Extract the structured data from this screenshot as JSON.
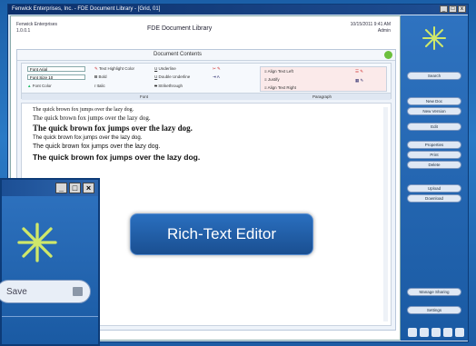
{
  "window": {
    "title": "Fenwick Enterprises, Inc. - FDE Document Library - [Grid, 01]"
  },
  "header": {
    "left_lines": [
      "Fenwick Enterprises",
      "1.0.0.1"
    ],
    "title": "FDE Document Library",
    "right_lines": [
      "10/15/2011 9:41 AM",
      "Admin"
    ]
  },
  "panel": {
    "title": "Document Contents"
  },
  "ribbon": {
    "font_select": "Font Arial",
    "size_select": "Font Size 10",
    "color_select": "Font Color",
    "items": {
      "highlight": "Text Highlight Color",
      "bold": "Bold",
      "italic": "Italic",
      "underline": "Underline",
      "double_underline": "Double Underline",
      "strikethrough": "Strikethrough",
      "align_center": "Align Text Left",
      "justify": "Justify",
      "align_right": "Align Text Right"
    },
    "group_font": "Font",
    "group_paragraph": "Paragraph"
  },
  "document": {
    "lines": [
      "The quick brown fox jumps over the lazy dog.",
      "The quick brown fox jumps over the lazy dog.",
      "The quick brown fox jumps over the lazy dog.",
      "The quick brown fox jumps over the lazy dog.",
      "The quick brown fox jumps over the lazy dog.",
      "The quick brown fox jumps over the lazy dog."
    ]
  },
  "sidebar": {
    "buttons": [
      "Search",
      "New Doc",
      "New Version",
      "Edit",
      "Properties",
      "Print",
      "Delete",
      "Upload",
      "Download",
      "Manage Sharing",
      "Settings"
    ]
  },
  "secondary": {
    "save_label": "Save"
  },
  "callout": {
    "label": "Rich-Text Editor"
  },
  "colors": {
    "accent": "#1f5fa8",
    "callout": "#1a4f91"
  }
}
